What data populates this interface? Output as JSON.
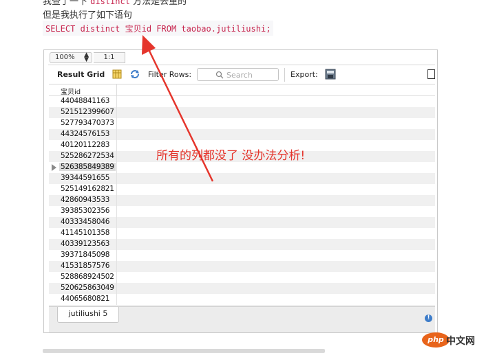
{
  "article": {
    "line_top_prefix": "我查了一下",
    "line_top_code": "distinct",
    "line_top_suffix": "方法是去重的",
    "line2": "但是我执行了如下语句",
    "sql": "SELECT distinct 宝贝id FROM taobao.jutiliushi;"
  },
  "workbench": {
    "zoom": "100%",
    "ratio": "1:1",
    "toolbar": {
      "result_grid": "Result Grid",
      "filter_rows": "Filter Rows:",
      "search_placeholder": "Search",
      "export": "Export:"
    },
    "grid": {
      "column_header": "宝贝id",
      "rows": [
        "44048841163",
        "521512399607",
        "527793470373",
        "44324576153",
        "40120112283",
        "525286272534",
        "526385849389",
        "39344591655",
        "525149162821",
        "42860943533",
        "39385302356",
        "40333458046",
        "41145101358",
        "40339123563",
        "39371845098",
        "41531857576",
        "528868924502",
        "520625863049",
        "44065680821"
      ],
      "selected_index": 6
    },
    "result_tab": "jutiliushi 5"
  },
  "annotation": {
    "text": "所有的列都没了 没办法分析!",
    "color": "#e5352c"
  },
  "watermark": {
    "logo": "php",
    "site": "中文网"
  },
  "colors": {
    "code": "#c7254e",
    "alt_row": "#f0f0f0",
    "accent_icon": "#3d7cc9"
  }
}
